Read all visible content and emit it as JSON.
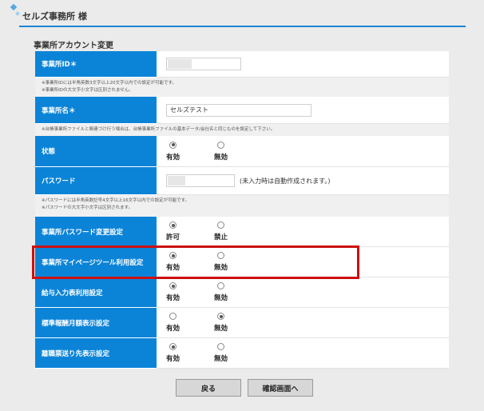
{
  "header": {
    "title": "セルズ事務所 様"
  },
  "page": {
    "section_title": "事業所アカウント変更"
  },
  "fields": {
    "office_id": {
      "label": "事業所ID＊",
      "notes": [
        "※事業所IDには半角英数3文字以上20文字以内での設定が可能です。",
        "※事業所IDの大文字小文字は区別されません。"
      ]
    },
    "office_name": {
      "label": "事業所名＊",
      "value": "セルズテスト",
      "notes": [
        "※台帳事業所ファイルと関連づけ行う場合は、台帳事業所ファイルの基本データ/会社名と同じものを設定して下さい。"
      ]
    },
    "status": {
      "label": "状態",
      "options": [
        "有効",
        "無効"
      ],
      "selected": "有効"
    },
    "password": {
      "label": "パスワード",
      "suffix": "(未入力時は自動作成されます。)",
      "notes": [
        "※パスワードには半角英数記号4文字以上16文字以内での設定が可能です。",
        "※パスワードの大文字小文字は区別されます。"
      ]
    },
    "pw_change": {
      "label": "事業所パスワード変更設定",
      "options": [
        "許可",
        "禁止"
      ],
      "selected": "許可"
    },
    "mypage_tool": {
      "label": "事業所マイページツール利用設定",
      "options": [
        "有効",
        "無効"
      ],
      "selected": "有効"
    },
    "salary_input": {
      "label": "給与入力表利用設定",
      "options": [
        "有効",
        "無効"
      ],
      "selected": "有効"
    },
    "standard_pay": {
      "label": "標準報酬月額表示設定",
      "options": [
        "有効",
        "無効"
      ],
      "selected": "無効"
    },
    "resignation": {
      "label": "離職票送り先表示設定",
      "options": [
        "有効",
        "無効"
      ],
      "selected": "有効"
    }
  },
  "buttons": {
    "back": "戻る",
    "confirm": "確認画面へ"
  },
  "colors": {
    "label_bg": "#0b84d8",
    "highlight": "#cc1010",
    "accent": "#1b86d6"
  }
}
